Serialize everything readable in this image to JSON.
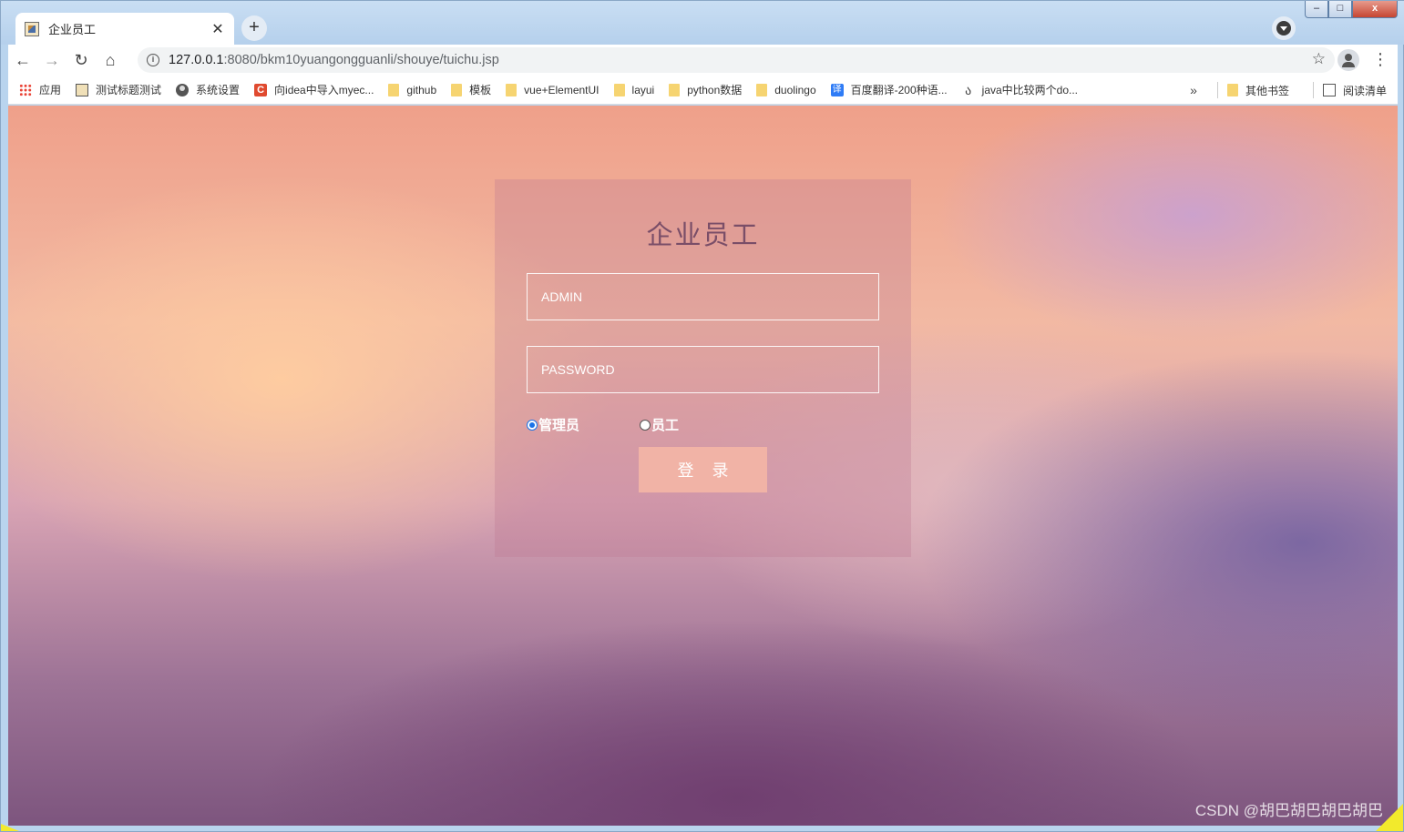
{
  "browser": {
    "tab_title": "企业员工",
    "tab_close": "✕",
    "new_tab": "+",
    "url_host": "127.0.0.1",
    "url_rest": ":8080/bkm10yuangongguanli/shouye/tuichu.jsp",
    "nav": {
      "back": "←",
      "forward": "→",
      "reload": "↻",
      "home": "⌂"
    },
    "star": "☆",
    "menu": "⋮",
    "window_controls": {
      "minimize": "–",
      "maximize": "□",
      "close": "x"
    }
  },
  "bookmarks": {
    "items": [
      {
        "label": "应用",
        "icon": "apps-icon"
      },
      {
        "label": "测试标题测试",
        "icon": "page-icon"
      },
      {
        "label": "系统设置",
        "icon": "globe-icon"
      },
      {
        "label": "向idea中导入myec...",
        "icon": "csdn-icon"
      },
      {
        "label": "github",
        "icon": "folder-icon"
      },
      {
        "label": "模板",
        "icon": "folder-icon"
      },
      {
        "label": "vue+ElementUI",
        "icon": "folder-icon"
      },
      {
        "label": "layui",
        "icon": "folder-icon"
      },
      {
        "label": "python数据",
        "icon": "folder-icon"
      },
      {
        "label": "duolingo",
        "icon": "folder-icon"
      },
      {
        "label": "百度翻译-200种语...",
        "icon": "fanyi-icon"
      },
      {
        "label": "java中比较两个do...",
        "icon": "java-icon"
      }
    ],
    "overflow": "»",
    "other": "其他书签",
    "reading_list": "阅读清单"
  },
  "login": {
    "title": "企业员工",
    "username_placeholder": "ADMIN",
    "password_placeholder": "PASSWORD",
    "role_admin": "管理员",
    "role_employee": "员工",
    "selected_role": "管理员",
    "submit": "登录"
  },
  "watermark": "CSDN @胡巴胡巴胡巴胡巴",
  "colors": {
    "login_button": "#f1b3a6",
    "title": "#7a4e68"
  }
}
